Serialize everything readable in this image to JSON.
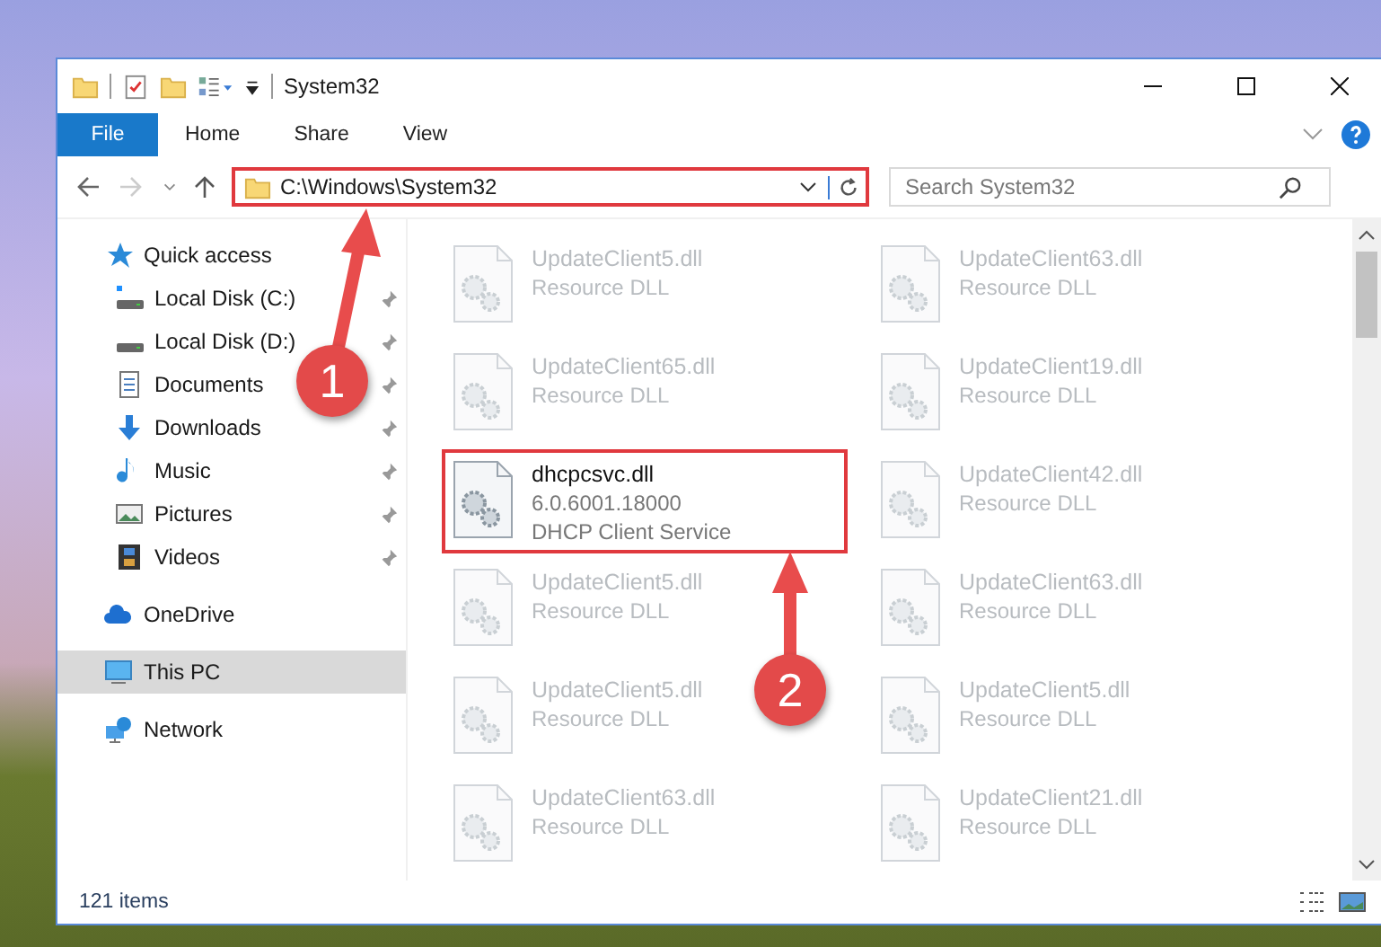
{
  "window": {
    "title": "System32"
  },
  "ribbon_tabs": [
    {
      "label": "File",
      "selected": true
    },
    {
      "label": "Home",
      "selected": false
    },
    {
      "label": "Share",
      "selected": false
    },
    {
      "label": "View",
      "selected": false
    }
  ],
  "address_bar": {
    "path": "C:\\Windows\\System32",
    "highlighted": true
  },
  "search": {
    "placeholder": "Search System32"
  },
  "sidebar": {
    "items": [
      {
        "label": "Quick access",
        "kind": "star",
        "selected": false,
        "children": [
          {
            "label": "Local Disk (C:)",
            "kind": "drive-c",
            "pinned": true
          },
          {
            "label": "Local Disk (D:)",
            "kind": "drive",
            "pinned": true
          },
          {
            "label": "Documents",
            "kind": "document",
            "pinned": true
          },
          {
            "label": "Downloads",
            "kind": "download",
            "pinned": true
          },
          {
            "label": "Music",
            "kind": "music",
            "pinned": true
          },
          {
            "label": "Pictures",
            "kind": "pictures",
            "pinned": true
          },
          {
            "label": "Videos",
            "kind": "videos",
            "pinned": true
          }
        ]
      },
      {
        "label": "OneDrive",
        "kind": "cloud",
        "selected": false
      },
      {
        "label": "This PC",
        "kind": "pc",
        "selected": true
      },
      {
        "label": "Network",
        "kind": "network",
        "selected": false
      }
    ]
  },
  "files": [
    {
      "name": "UpdateClient5.dll",
      "details": [
        "Resource DLL"
      ],
      "dimmed": true,
      "highlighted": false
    },
    {
      "name": "UpdateClient63.dll",
      "details": [
        "Resource DLL"
      ],
      "dimmed": true,
      "highlighted": false
    },
    {
      "name": "UpdateClient65.dll",
      "details": [
        "Resource DLL"
      ],
      "dimmed": true,
      "highlighted": false
    },
    {
      "name": "UpdateClient19.dll",
      "details": [
        "Resource DLL"
      ],
      "dimmed": true,
      "highlighted": false
    },
    {
      "name": "dhcpcsvc.dll",
      "details": [
        "6.0.6001.18000",
        "DHCP Client Service"
      ],
      "dimmed": false,
      "highlighted": true
    },
    {
      "name": "UpdateClient42.dll",
      "details": [
        "Resource DLL"
      ],
      "dimmed": true,
      "highlighted": false
    },
    {
      "name": "UpdateClient5.dll",
      "details": [
        "Resource DLL"
      ],
      "dimmed": true,
      "highlighted": false
    },
    {
      "name": "UpdateClient63.dll",
      "details": [
        "Resource DLL"
      ],
      "dimmed": true,
      "highlighted": false
    },
    {
      "name": "UpdateClient5.dll",
      "details": [
        "Resource DLL"
      ],
      "dimmed": true,
      "highlighted": false
    },
    {
      "name": "UpdateClient5.dll",
      "details": [
        "Resource DLL"
      ],
      "dimmed": true,
      "highlighted": false
    },
    {
      "name": "UpdateClient63.dll",
      "details": [
        "Resource DLL"
      ],
      "dimmed": true,
      "highlighted": false
    },
    {
      "name": "UpdateClient21.dll",
      "details": [
        "Resource DLL"
      ],
      "dimmed": true,
      "highlighted": false
    }
  ],
  "status_bar": {
    "item_count": "121 items"
  },
  "annotations": [
    {
      "label": "1"
    },
    {
      "label": "2"
    }
  ]
}
